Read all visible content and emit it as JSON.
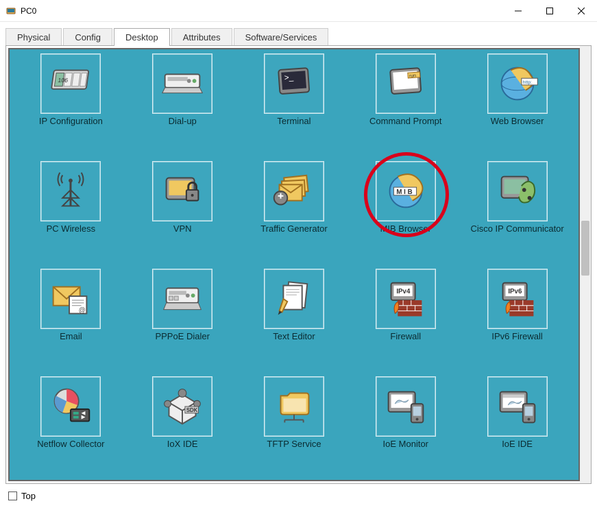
{
  "window": {
    "title": "PC0",
    "top_checkbox_label": "Top"
  },
  "tabs": {
    "items": [
      {
        "label": "Physical",
        "active": false
      },
      {
        "label": "Config",
        "active": false
      },
      {
        "label": "Desktop",
        "active": true
      },
      {
        "label": "Attributes",
        "active": false
      },
      {
        "label": "Software/Services",
        "active": false
      }
    ]
  },
  "apps": [
    {
      "label": "IP Configuration",
      "icon": "ip-config-icon"
    },
    {
      "label": "Dial-up",
      "icon": "dialup-icon"
    },
    {
      "label": "Terminal",
      "icon": "terminal-icon"
    },
    {
      "label": "Command Prompt",
      "icon": "cmd-icon"
    },
    {
      "label": "Web Browser",
      "icon": "browser-icon"
    },
    {
      "label": "PC Wireless",
      "icon": "wireless-icon"
    },
    {
      "label": "VPN",
      "icon": "vpn-icon"
    },
    {
      "label": "Traffic Generator",
      "icon": "traffic-icon"
    },
    {
      "label": "MIB Browser",
      "icon": "mib-icon"
    },
    {
      "label": "Cisco IP Communicator",
      "icon": "ipcomm-icon"
    },
    {
      "label": "Email",
      "icon": "email-icon"
    },
    {
      "label": "PPPoE Dialer",
      "icon": "pppoe-icon"
    },
    {
      "label": "Text Editor",
      "icon": "texteditor-icon"
    },
    {
      "label": "Firewall",
      "icon": "firewall-icon"
    },
    {
      "label": "IPv6 Firewall",
      "icon": "firewall6-icon"
    },
    {
      "label": "Netflow Collector",
      "icon": "netflow-icon"
    },
    {
      "label": "IoX IDE",
      "icon": "iox-icon"
    },
    {
      "label": "TFTP Service",
      "icon": "tftp-icon"
    },
    {
      "label": "IoE Monitor",
      "icon": "ioemon-icon"
    },
    {
      "label": "IoE IDE",
      "icon": "ioeide-icon"
    }
  ],
  "highlight": {
    "index": 8
  }
}
